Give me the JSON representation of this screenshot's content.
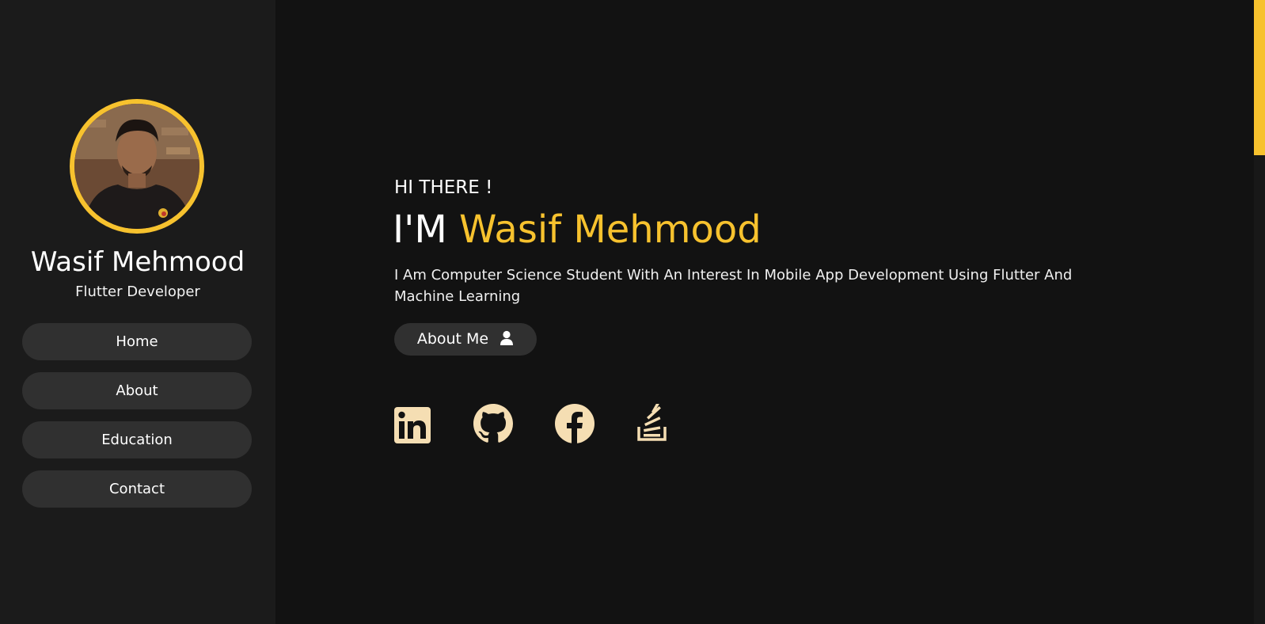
{
  "sidebar": {
    "name": "Wasif Mehmood",
    "role": "Flutter Developer",
    "nav": [
      {
        "label": "Home"
      },
      {
        "label": "About"
      },
      {
        "label": "Education"
      },
      {
        "label": "Contact"
      }
    ]
  },
  "hero": {
    "greeting": "HI THERE !",
    "prefix": "I'M ",
    "name": "Wasif Mehmood",
    "intro": "I Am Computer Science Student With An Interest In Mobile App Development Using Flutter And Machine Learning",
    "about_button": "About Me"
  },
  "social": [
    {
      "icon": "linkedin-icon"
    },
    {
      "icon": "github-icon"
    },
    {
      "icon": "facebook-icon"
    },
    {
      "icon": "stackoverflow-icon"
    }
  ],
  "colors": {
    "accent": "#f7c22e",
    "background": "#121212",
    "sidebar": "#1b1b1b",
    "button": "#303030",
    "social_icons": "#f5deb3"
  }
}
